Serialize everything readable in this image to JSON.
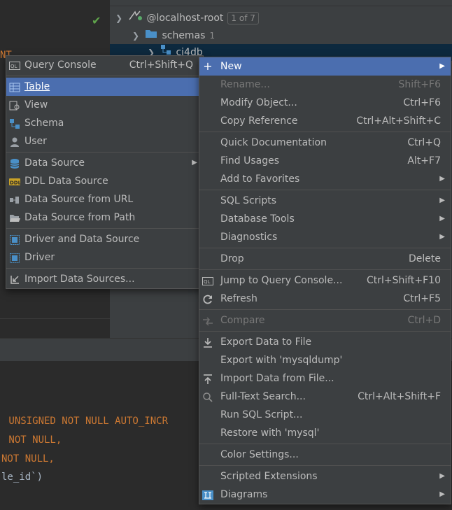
{
  "tree": {
    "root_label": "@localhost-root",
    "root_badge": "1 of 7",
    "schemas_label": "schemas",
    "schemas_count": "1",
    "db_label": "ci4db"
  },
  "editor_fragment": {
    "line0": "NT",
    "line1_kw": " UNSIGNED NOT NULL AUTO_INCR",
    "line2_kw": " NOT NULL,",
    "line3_kw": "NOT NULL,",
    "line4": "le_id`)"
  },
  "new_submenu": {
    "query_console": {
      "label": "Query Console",
      "shortcut": "Ctrl+Shift+Q"
    },
    "table": "Table",
    "view": "View",
    "schema": "Schema",
    "user": "User",
    "data_source": "Data Source",
    "ddl_data_source": "DDL Data Source",
    "ds_from_url": "Data Source from URL",
    "ds_from_path": "Data Source from Path",
    "driver_and_ds": "Driver and Data Source",
    "driver": "Driver",
    "import_ds": "Import Data Sources..."
  },
  "context_menu": {
    "new": "New",
    "rename": {
      "label": "Rename...",
      "shortcut": "Shift+F6"
    },
    "modify": {
      "label": "Modify Object...",
      "shortcut": "Ctrl+F6"
    },
    "copy_ref": {
      "label": "Copy Reference",
      "shortcut": "Ctrl+Alt+Shift+C"
    },
    "quick_doc": {
      "label": "Quick Documentation",
      "shortcut": "Ctrl+Q"
    },
    "find_usages": {
      "label": "Find Usages",
      "shortcut": "Alt+F7"
    },
    "add_fav": "Add to Favorites",
    "sql_scripts": "SQL Scripts",
    "db_tools": "Database Tools",
    "diagnostics": "Diagnostics",
    "drop": {
      "label": "Drop",
      "shortcut": "Delete"
    },
    "jump_console": {
      "label": "Jump to Query Console...",
      "shortcut": "Ctrl+Shift+F10"
    },
    "refresh": {
      "label": "Refresh",
      "shortcut": "Ctrl+F5"
    },
    "compare": {
      "label": "Compare",
      "shortcut": "Ctrl+D"
    },
    "export_file": "Export Data to File",
    "export_mysqldump": "Export with 'mysqldump'",
    "import_file": "Import Data from File...",
    "fulltext": {
      "label": "Full-Text Search...",
      "shortcut": "Ctrl+Alt+Shift+F"
    },
    "run_sql": "Run SQL Script...",
    "restore": "Restore with 'mysql'",
    "color_settings": "Color Settings...",
    "scripted_ext": "Scripted Extensions",
    "diagrams": "Diagrams"
  },
  "colors": {
    "selection": "#4b6eaf",
    "menu_bg": "#3c3f41",
    "keyword": "#cc7832",
    "folder": "#4a90c8"
  }
}
